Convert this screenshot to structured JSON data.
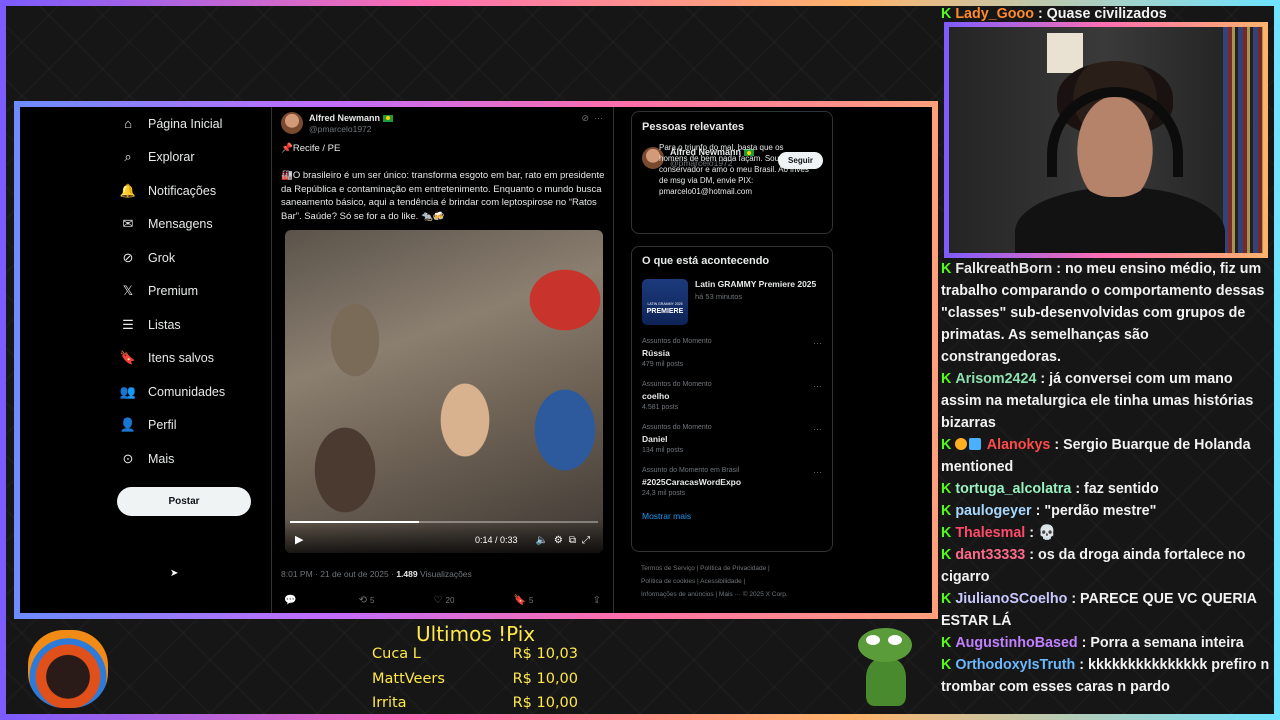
{
  "nav": {
    "items": [
      {
        "label": "Página Inicial",
        "icon": "home-icon"
      },
      {
        "label": "Explorar",
        "icon": "search-icon"
      },
      {
        "label": "Notificações",
        "icon": "bell-icon"
      },
      {
        "label": "Mensagens",
        "icon": "mail-icon"
      },
      {
        "label": "Grok",
        "icon": "grok-icon"
      },
      {
        "label": "Premium",
        "icon": "x-logo-icon"
      },
      {
        "label": "Listas",
        "icon": "list-icon"
      },
      {
        "label": "Itens salvos",
        "icon": "bookmark-icon"
      },
      {
        "label": "Comunidades",
        "icon": "people-icon"
      },
      {
        "label": "Perfil",
        "icon": "person-icon"
      },
      {
        "label": "Mais",
        "icon": "more-circle-icon"
      }
    ],
    "post_label": "Postar"
  },
  "tweet": {
    "author_name": "Alfred Newmann",
    "author_handle": "@pmarcelo1972",
    "location": "📌Recife / PE",
    "text": "🏭O brasileiro é um ser único: transforma esgoto em bar, rato em presidente da República e contaminação em entretenimento. Enquanto o mundo busca saneamento básico, aqui a tendência é brindar com leptospirose no “Ratos Bar”. Saúde? Só se for a do like. 🐀🍻",
    "video_time": "0:14 / 0:33",
    "video_progress": 0.42,
    "posted_at": "8:01 PM · 21 de out de 2025 · ",
    "views": "1.489",
    "views_label": "Visualizações",
    "retweets": "5",
    "likes": "20",
    "bookmarks": "5"
  },
  "relevant": {
    "title": "Pessoas relevantes",
    "name": "Alfred Newmann",
    "handle": "@pmarcelo1972",
    "follow_label": "Seguir",
    "bio": "Para o triunfo do mal, basta que os homens de bem nada façam. Sou conservador e amo o meu Brasil. Ao invés de msg via DM, envie PIX: pmarcelo01@hotmail.com"
  },
  "trends": {
    "title": "O que está acontecendo",
    "featured_title": "Latin GRAMMY Premiere 2025",
    "featured_sub": "há 53 minutos",
    "featured_img_label": "PREMIERE",
    "featured_img_small": "LATIN GRAMMY 2025",
    "items": [
      {
        "context": "Assuntos do Momento",
        "name": "Rússia",
        "count": "479 mil posts"
      },
      {
        "context": "Assuntos do Momento",
        "name": "coelho",
        "count": "4.581 posts"
      },
      {
        "context": "Assuntos do Momento",
        "name": "Daniel",
        "count": "134 mil posts"
      },
      {
        "context": "Assunto do Momento em Brasil",
        "name": "#2025CaracasWordExpo",
        "count": "24,3 mil posts"
      }
    ],
    "show_more": "Mostrar mais"
  },
  "footer": {
    "line1": "Termos de Serviço  |  Política de Privacidade  |",
    "line2": "Política de cookies  |  Acessibilidade  |",
    "line3": "Informações de anúncios  |  Mais ···  © 2025 X Corp."
  },
  "chat_top": {
    "user": "Lady_Gooo",
    "text": ": Quase civilizados",
    "color": "#ff8a2b"
  },
  "chat": [
    {
      "user": "FalkreathBorn",
      "color": "#e8e8e8",
      "text": ": no meu ensino médio, fiz um trabalho comparando o comportamento dessas \"classes\" sub-desenvolvidas com grupos de primatas. As semelhanças são constrangedoras."
    },
    {
      "user": "Arisom2424",
      "color": "#8fe0b0",
      "text": ": já conversei com um mano assim na metalurgica ele tinha umas histórias bizarras"
    },
    {
      "user": "Alanokys",
      "color": "#ff4a4a",
      "text": ": Sergio Buarque de Holanda mentioned",
      "badges": true
    },
    {
      "user": "tortuga_alcolatra",
      "color": "#9af0c0",
      "text": ": faz sentido"
    },
    {
      "user": "paulogeyer",
      "color": "#a8d8ff",
      "text": ": \"perdão mestre\""
    },
    {
      "user": "Thalesmal",
      "color": "#ff4a6a",
      "text": ": 💀"
    },
    {
      "user": "dant33333",
      "color": "#ff6a8a",
      "text": ": os da droga ainda fortalece no cigarro"
    },
    {
      "user": "JiulianoSCoelho",
      "color": "#c8c8ff",
      "text": ": PARECE QUE VC QUERIA ESTAR LÁ"
    },
    {
      "user": "AugustinhoBased",
      "color": "#c080ff",
      "text": ": Porra a semana inteira"
    },
    {
      "user": "OrthodoxyIsTruth",
      "color": "#6ab8ff",
      "text": ": kkkkkkkkkkkkkkk prefiro n trombar com esses caras n pardo"
    }
  ],
  "pix": {
    "title": "Ultimos !Pix",
    "rows": [
      {
        "name": "Cuca L",
        "amount": "R$ 10,03"
      },
      {
        "name": "MattVeers",
        "amount": "R$ 10,00"
      },
      {
        "name": "Irrita",
        "amount": "R$ 10,00"
      }
    ]
  },
  "colors": {
    "kick_green": "#53fc18",
    "pix_yellow": "#ffe84a",
    "link_blue": "#1d9bf0"
  }
}
